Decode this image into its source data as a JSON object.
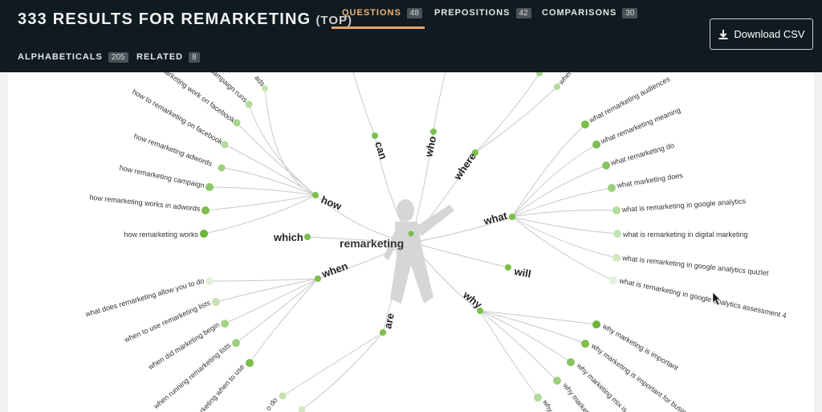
{
  "header": {
    "results_count": "333",
    "results_text": "RESULTS FOR REMARKETING",
    "scope": "(TOP)",
    "download_label": "Download CSV",
    "tabs": [
      {
        "label": "QUESTIONS",
        "count": "48"
      },
      {
        "label": "PREPOSITIONS",
        "count": "42"
      },
      {
        "label": "COMPARISONS",
        "count": "30"
      },
      {
        "label": "ALPHABETICALS",
        "count": "205"
      },
      {
        "label": "RELATED",
        "count": "8"
      }
    ]
  },
  "wheel": {
    "center": "remarketing",
    "hubs": [
      "how",
      "can",
      "who",
      "where",
      "what",
      "which",
      "will",
      "when",
      "why",
      "are"
    ],
    "how": [
      "campaign runs",
      "ads",
      "marketing work on facebook",
      "how to remarketing on facebook",
      "how remarketing adwords",
      "how remarketing campaign",
      "how remarketing works in adwords",
      "how remarketing works"
    ],
    "what": [
      "what remarketing audiences",
      "what remarketing meaning",
      "what remarketing do",
      "what marketing does",
      "what is remarketing in google analytics",
      "what is remarketing in digital marketing",
      "what is remarketing in google analytics quizlet",
      "what is remarketing in google analytics assessment 4"
    ],
    "when": [
      "what does remarketing allow you to do",
      "when to use remarketing lists",
      "when did marketing begin",
      "when running remarketing lists",
      "marketing when to use"
    ],
    "why": [
      "why marketing is important",
      "why marketing is important for busin",
      "why marketing mix is",
      "why marketing",
      "why"
    ],
    "where": [
      "where"
    ],
    "are": [
      "o do"
    ]
  }
}
